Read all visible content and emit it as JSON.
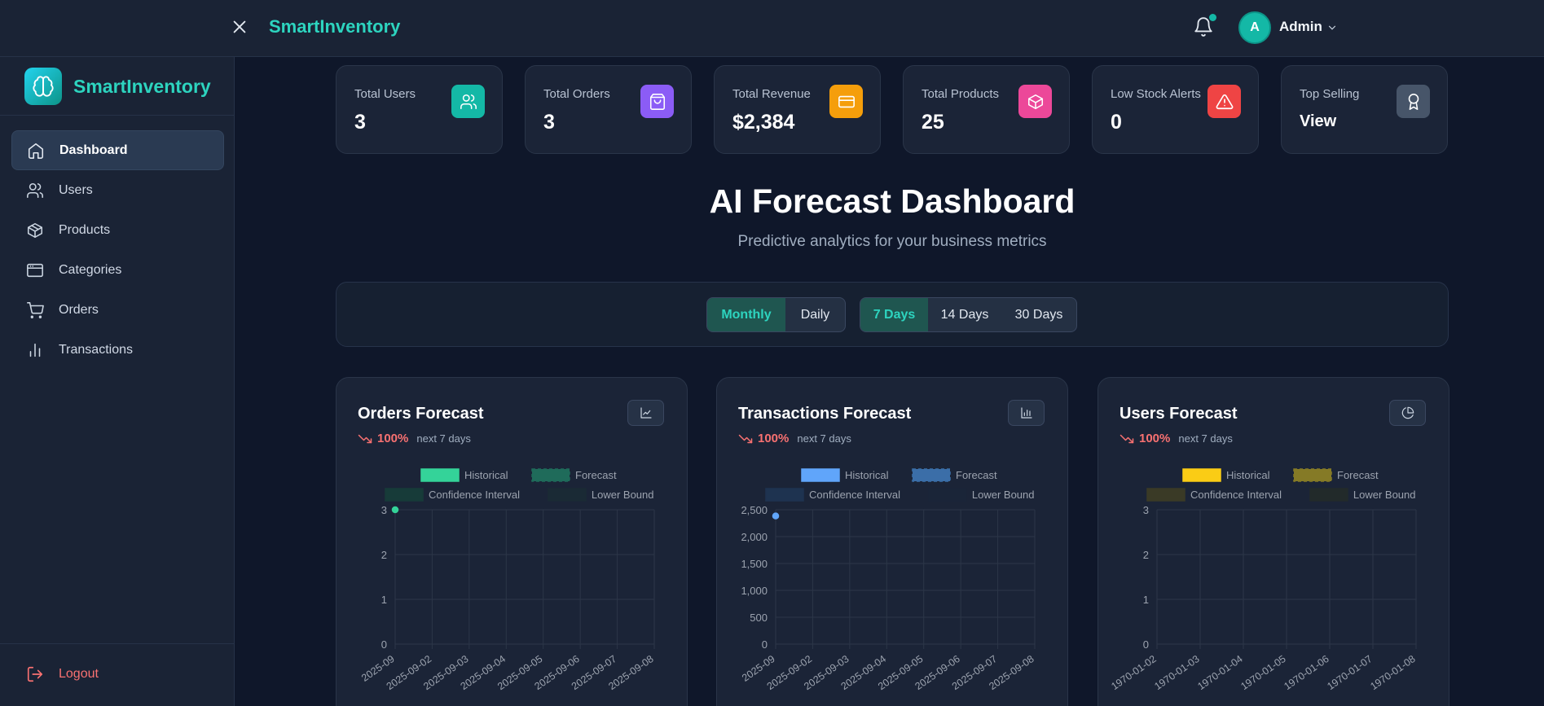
{
  "topbar": {
    "brand": "SmartInventory",
    "user_initial": "A",
    "user_name": "Admin"
  },
  "sidebar": {
    "brand": "SmartInventory",
    "items": [
      {
        "label": "Dashboard",
        "icon": "home-icon",
        "active": true
      },
      {
        "label": "Users",
        "icon": "users-icon"
      },
      {
        "label": "Products",
        "icon": "box-icon"
      },
      {
        "label": "Categories",
        "icon": "window-icon"
      },
      {
        "label": "Orders",
        "icon": "cart-icon"
      },
      {
        "label": "Transactions",
        "icon": "bar-chart-icon"
      }
    ],
    "logout": "Logout"
  },
  "stats": [
    {
      "label": "Total Users",
      "value": "3",
      "icon": "users-icon",
      "color": "#14b8a6"
    },
    {
      "label": "Total Orders",
      "value": "3",
      "icon": "shopping-bag-icon",
      "color": "#8b5cf6"
    },
    {
      "label": "Total Revenue",
      "value": "$2,384",
      "icon": "credit-card-icon",
      "color": "#f59e0b"
    },
    {
      "label": "Total Products",
      "value": "25",
      "icon": "package-icon",
      "color": "#ec4899"
    },
    {
      "label": "Low Stock Alerts",
      "value": "0",
      "icon": "alert-triangle-icon",
      "color": "#ef4444"
    },
    {
      "label": "Top Selling",
      "value": "View",
      "icon": "award-icon",
      "color": "#475569"
    }
  ],
  "heading": {
    "title": "AI Forecast Dashboard",
    "subtitle": "Predictive analytics for your business metrics"
  },
  "filters": {
    "granularity": [
      "Monthly",
      "Daily"
    ],
    "granularity_selected": "Monthly",
    "range": [
      "7 Days",
      "14 Days",
      "30 Days"
    ],
    "range_selected": "7 Days"
  },
  "charts": [
    {
      "title": "Orders Forecast",
      "trend": "100%",
      "period": "next 7 days",
      "button_icon": "line-chart-icon"
    },
    {
      "title": "Transactions Forecast",
      "trend": "100%",
      "period": "next 7 days",
      "button_icon": "bar-chart-icon"
    },
    {
      "title": "Users Forecast",
      "trend": "100%",
      "period": "next 7 days",
      "button_icon": "pie-chart-icon"
    }
  ],
  "chart_data": [
    {
      "type": "line",
      "title": "",
      "legend": [
        "Historical",
        "Forecast",
        "Confidence Interval",
        "Lower Bound"
      ],
      "legend_placement": "top",
      "x": [
        "2025-09",
        "2025-09-02",
        "2025-09-03",
        "2025-09-04",
        "2025-09-05",
        "2025-09-06",
        "2025-09-07",
        "2025-09-08"
      ],
      "yticks": [
        "0",
        "1",
        "2",
        "3"
      ],
      "ylim": [
        0,
        3
      ],
      "series": [
        {
          "name": "Historical",
          "points": [
            {
              "x": "2025-09",
              "y": 3
            }
          ]
        }
      ],
      "colors": {
        "historical": "#34d399",
        "forecast": "#1f6b5a",
        "ci": "#173b39",
        "lower": "#1a2a35"
      },
      "grid": true
    },
    {
      "type": "line",
      "title": "",
      "legend": [
        "Historical",
        "Forecast",
        "Confidence Interval",
        "Lower Bound"
      ],
      "legend_placement": "top",
      "x": [
        "2025-09",
        "2025-09-02",
        "2025-09-03",
        "2025-09-04",
        "2025-09-05",
        "2025-09-06",
        "2025-09-07",
        "2025-09-08"
      ],
      "yticks": [
        "0",
        "500",
        "1,000",
        "1,500",
        "2,000",
        "2,500"
      ],
      "ylim": [
        0,
        2500
      ],
      "series": [
        {
          "name": "Historical",
          "points": [
            {
              "x": "2025-09",
              "y": 2384
            }
          ]
        }
      ],
      "colors": {
        "historical": "#60a5fa",
        "forecast": "#3b6ea8",
        "ci": "#1e3350",
        "lower": "#1a2538"
      },
      "grid": true
    },
    {
      "type": "line",
      "title": "",
      "legend": [
        "Historical",
        "Forecast",
        "Confidence Interval",
        "Lower Bound"
      ],
      "legend_placement": "top",
      "x": [
        "1970-01-02",
        "1970-01-03",
        "1970-01-04",
        "1970-01-05",
        "1970-01-06",
        "1970-01-07",
        "1970-01-08"
      ],
      "yticks": [
        "0",
        "1",
        "2",
        "3"
      ],
      "ylim": [
        0,
        3
      ],
      "series": [
        {
          "name": "Historical",
          "points": []
        }
      ],
      "colors": {
        "historical": "#facc15",
        "forecast": "#857a26",
        "ci": "#3a3a26",
        "lower": "#222a2a"
      },
      "grid": true
    }
  ]
}
